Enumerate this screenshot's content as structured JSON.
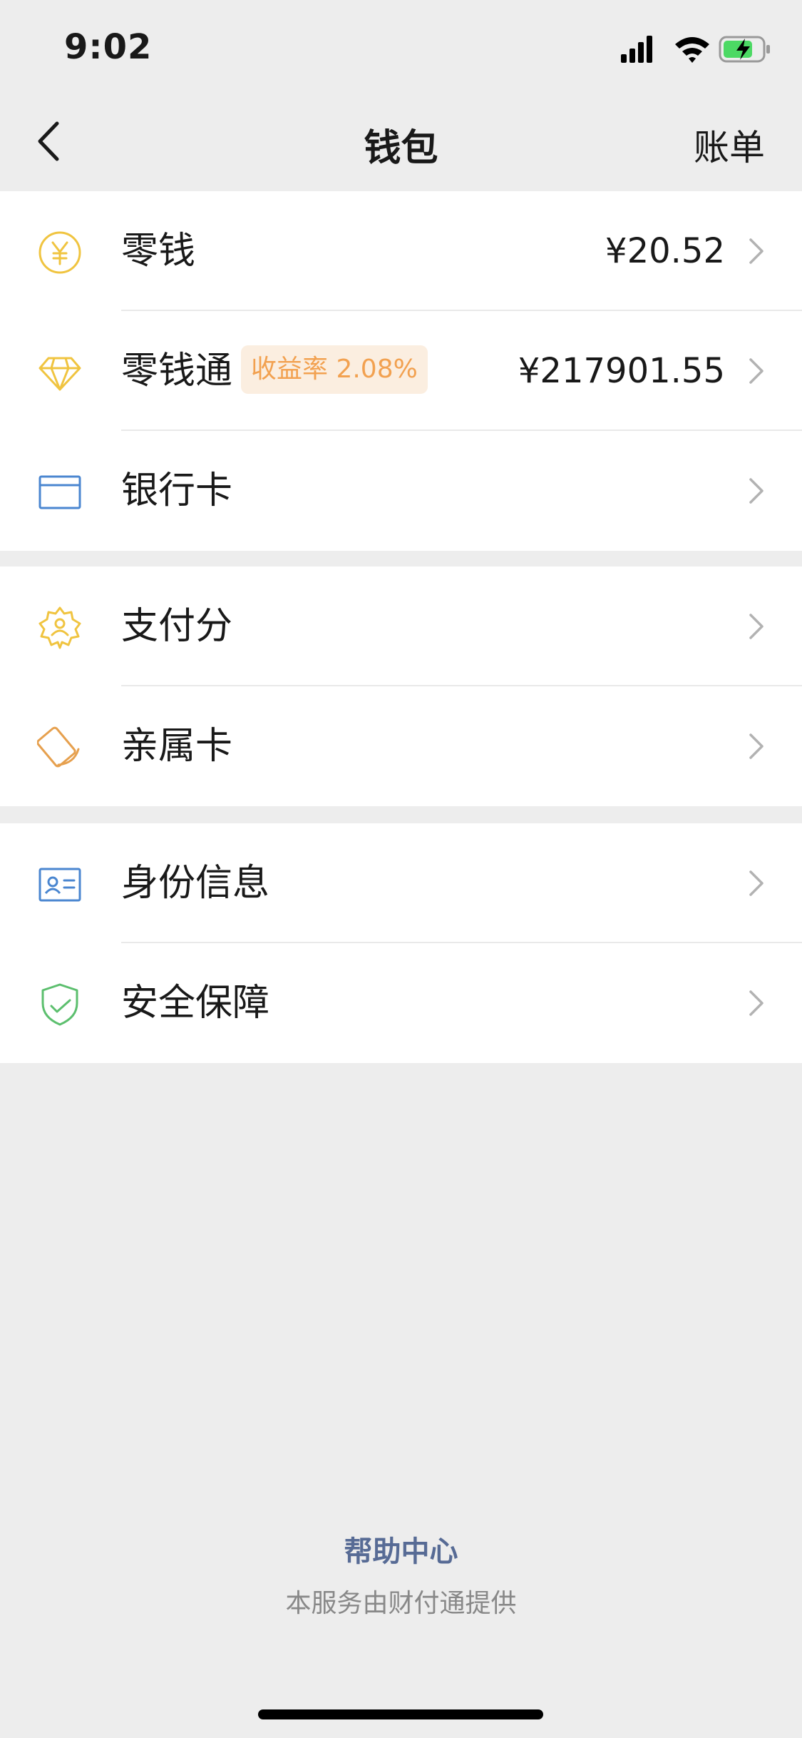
{
  "status_bar": {
    "time": "9:02"
  },
  "nav": {
    "title": "钱包",
    "right_label": "账单"
  },
  "groups": [
    {
      "items": [
        {
          "label": "零钱",
          "value": "¥20.52",
          "icon": "yuan-coin-icon"
        },
        {
          "label": "零钱通",
          "badge": "收益率 2.08%",
          "value": "¥217901.55",
          "icon": "diamond-icon"
        },
        {
          "label": "银行卡",
          "icon": "bank-card-icon"
        }
      ]
    },
    {
      "items": [
        {
          "label": "支付分",
          "icon": "payscore-icon"
        },
        {
          "label": "亲属卡",
          "icon": "family-card-icon"
        }
      ]
    },
    {
      "items": [
        {
          "label": "身份信息",
          "icon": "id-card-icon"
        },
        {
          "label": "安全保障",
          "icon": "shield-check-icon"
        }
      ]
    }
  ],
  "footer": {
    "help_link": "帮助中心",
    "provider_note": "本服务由财付通提供"
  },
  "colors": {
    "yellow": "#f0c440",
    "blue": "#4a86d0",
    "orange": "#e6a04e",
    "green": "#5cbf6e",
    "link": "#576b95"
  }
}
